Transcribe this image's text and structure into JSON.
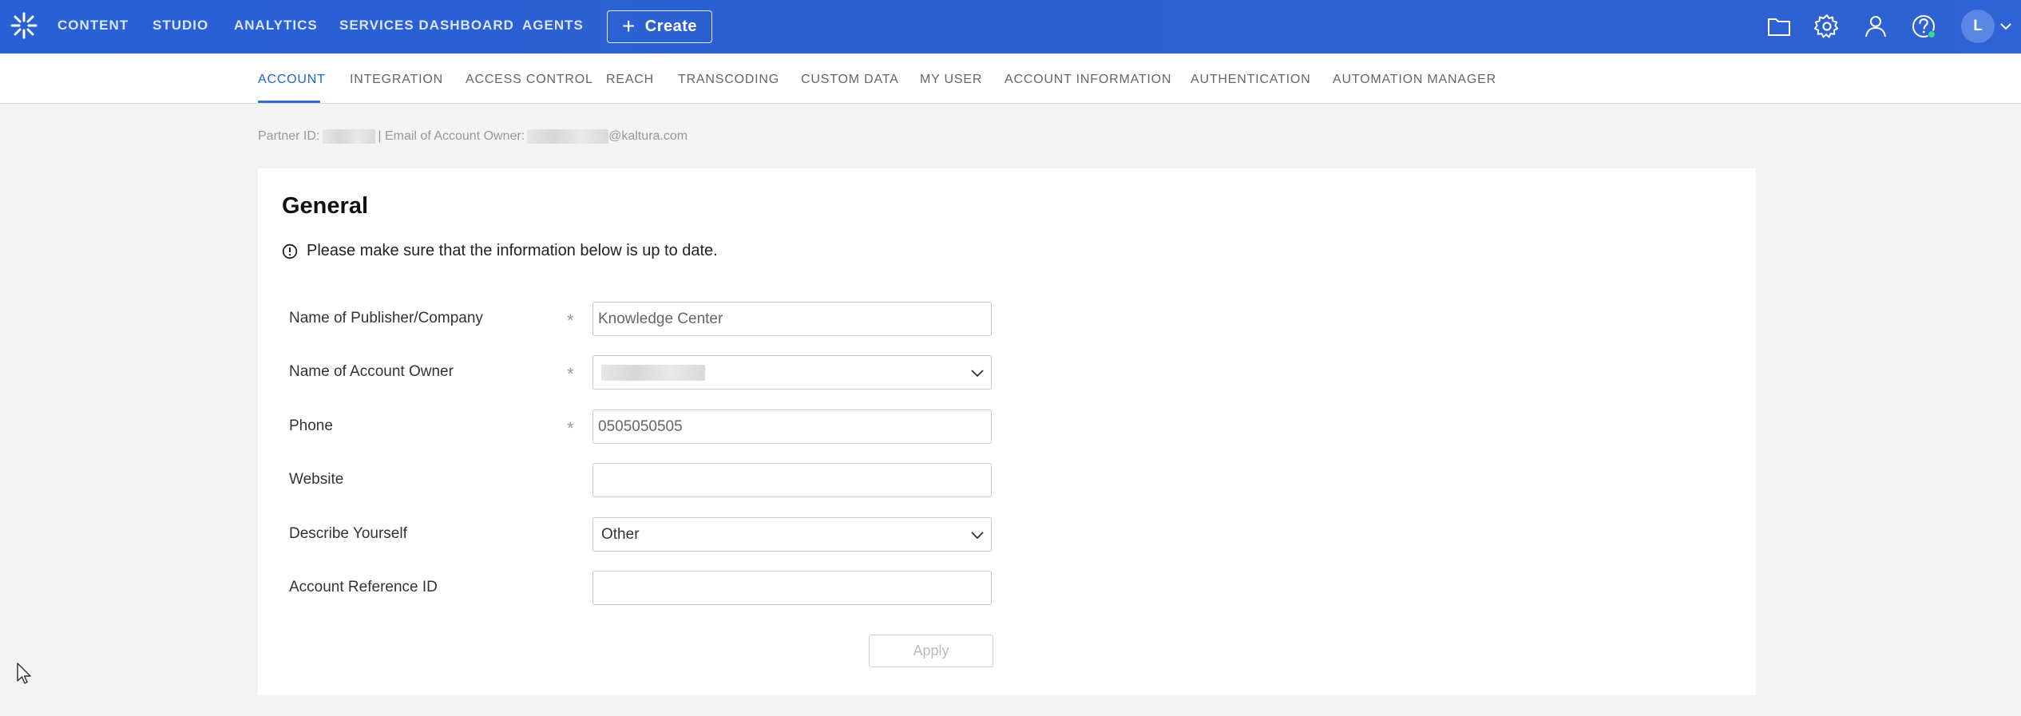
{
  "topbar": {
    "nav": [
      "CONTENT",
      "STUDIO",
      "ANALYTICS",
      "SERVICES DASHBOARD",
      "AGENTS"
    ],
    "create_label": "Create",
    "icons": [
      "folder-icon",
      "gear-icon",
      "user-icon",
      "help-icon"
    ],
    "avatar_initial": "L",
    "colors": {
      "bar": "#2a62d4",
      "help_status": "#3ad48b"
    }
  },
  "tabs": {
    "items": [
      "ACCOUNT",
      "INTEGRATION",
      "ACCESS CONTROL",
      "REACH",
      "TRANSCODING",
      "CUSTOM DATA",
      "MY USER",
      "ACCOUNT INFORMATION",
      "AUTHENTICATION",
      "AUTOMATION MANAGER"
    ],
    "active": "ACCOUNT"
  },
  "partner": {
    "partner_id_label": "Partner ID:",
    "separator": "| Email of Account Owner:",
    "email_domain": "@kaltura.com"
  },
  "general": {
    "title": "General",
    "notice": "Please make sure that the information below is up to date.",
    "fields": {
      "publisher": {
        "label": "Name of Publisher/Company",
        "required": "*",
        "value": "Knowledge Center"
      },
      "owner": {
        "label": "Name of Account Owner",
        "required": "*"
      },
      "phone": {
        "label": "Phone",
        "required": "*",
        "value": "0505050505"
      },
      "website": {
        "label": "Website",
        "value": ""
      },
      "describe": {
        "label": "Describe Yourself",
        "value": "Other"
      },
      "reference": {
        "label": "Account Reference ID",
        "value": ""
      }
    },
    "apply_label": "Apply"
  }
}
